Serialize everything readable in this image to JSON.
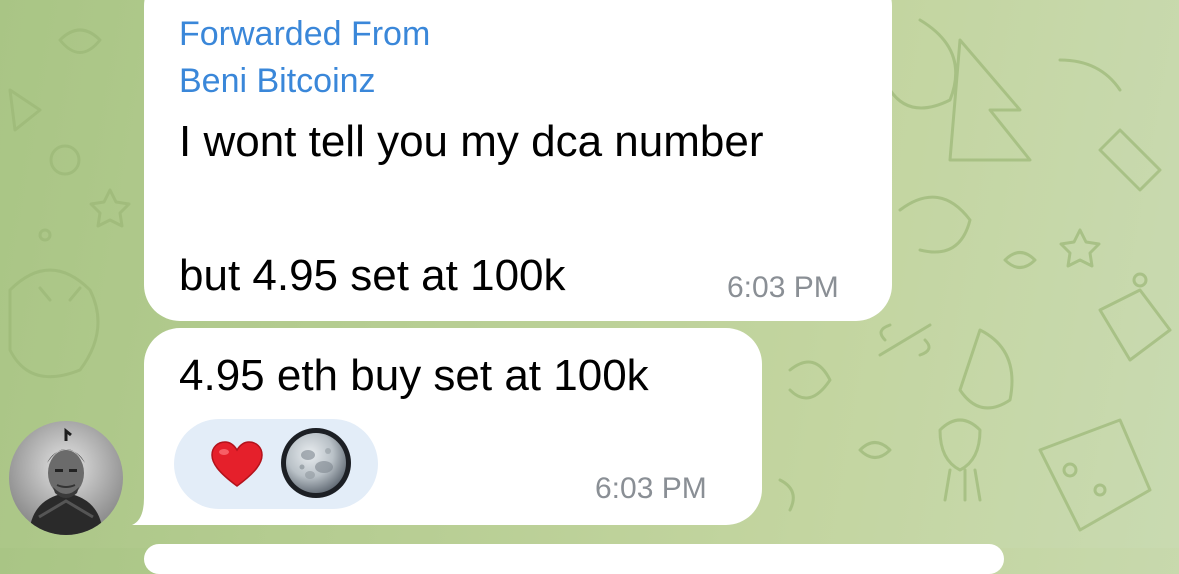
{
  "chat": {
    "messages": [
      {
        "forwarded_label": "Forwarded From",
        "forwarded_name": "Beni Bitcoinz",
        "lines": [
          "I wont tell you my dca number",
          "but 4.95 set at 100k"
        ],
        "time": "6:03 PM"
      },
      {
        "text": "4.95 eth buy set at 100k",
        "time": "6:03 PM",
        "reactions": [
          {
            "icon": "red-heart-icon"
          },
          {
            "icon": "full-moon-icon"
          }
        ]
      }
    ]
  },
  "colors": {
    "background": "#b6cd92",
    "bubble": "#ffffff",
    "forward_link": "#3a87d9",
    "timestamp": "#8a8f95",
    "reaction_pill": "#e3edf8",
    "heart": "#e5202b"
  }
}
